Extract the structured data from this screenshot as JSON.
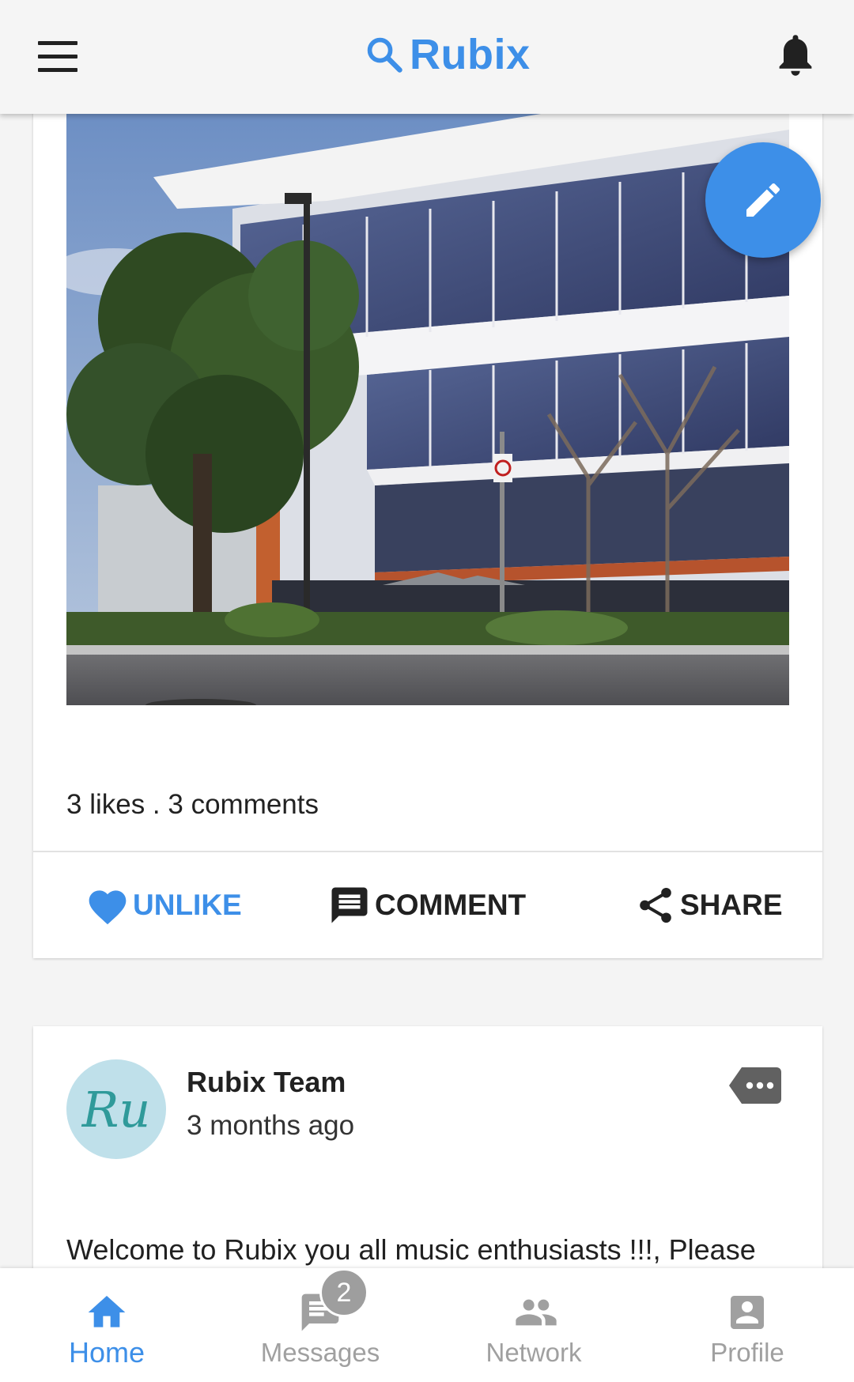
{
  "header": {
    "brand": "Rubix",
    "icons": [
      "menu-icon",
      "search-icon",
      "bell-icon"
    ],
    "brand_color": "#3d8fe8"
  },
  "fab": {
    "icon": "pencil-icon",
    "color": "#3d8fe8"
  },
  "post1": {
    "photo": "office-building-photo",
    "stats": "3 likes . 3 comments",
    "actions": {
      "unlike": "UNLIKE",
      "comment": "COMMENT",
      "share": "SHARE"
    }
  },
  "post2": {
    "avatar_text": "Ru",
    "author": "Rubix Team",
    "time": "3 months ago",
    "text": "Welcome to Rubix you all music enthusiasts !!!, Please"
  },
  "bottom_nav": {
    "items": [
      {
        "label": "Home",
        "icon": "home-icon",
        "active": true
      },
      {
        "label": "Messages",
        "icon": "message-icon",
        "badge": "2"
      },
      {
        "label": "Network",
        "icon": "people-icon"
      },
      {
        "label": "Profile",
        "icon": "profile-icon"
      }
    ],
    "active_color": "#3d8fe8",
    "inactive_color": "#a0a0a0"
  }
}
